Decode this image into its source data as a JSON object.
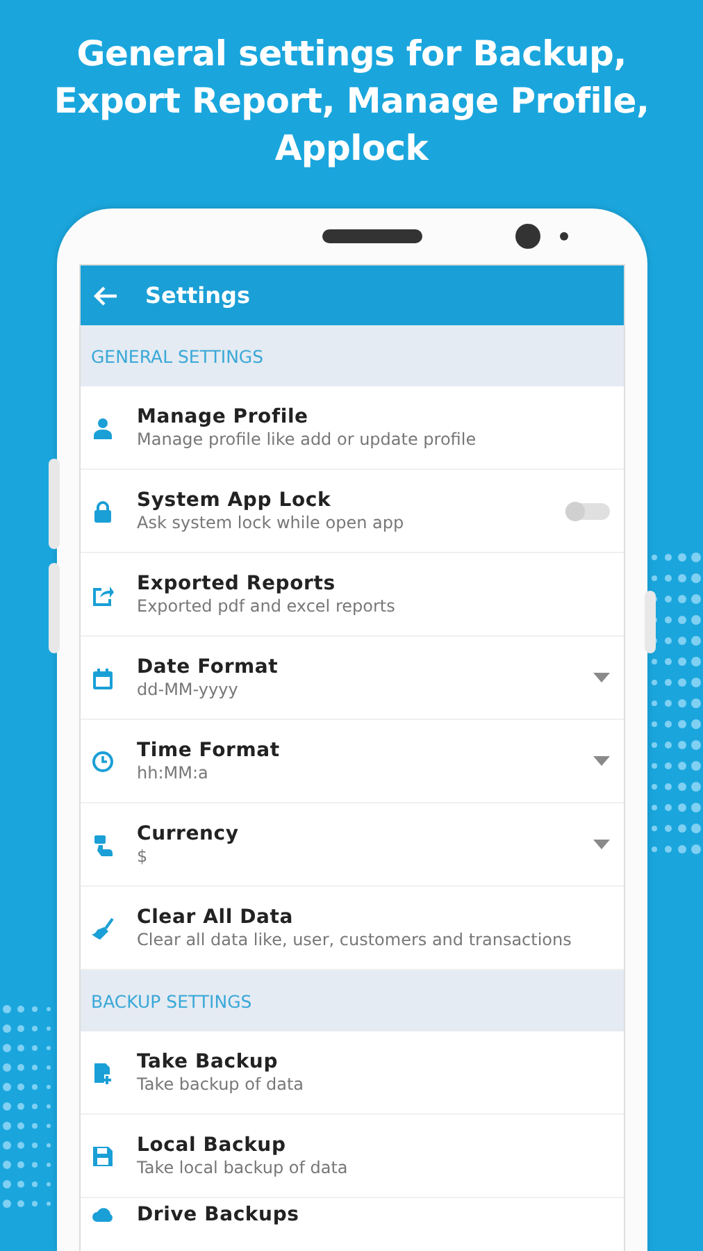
{
  "headline": "General settings for Backup, Export Report, Manage Profile, Applock",
  "app_bar": {
    "title": "Settings"
  },
  "sections": [
    {
      "header": "GENERAL SETTINGS",
      "items": [
        {
          "kind": "plain",
          "title": "Manage Profile",
          "subtitle": "Manage profile like add or update profile"
        },
        {
          "kind": "toggle",
          "title": "System App Lock",
          "subtitle": "Ask system lock while open app",
          "on": false
        },
        {
          "kind": "plain",
          "title": "Exported Reports",
          "subtitle": "Exported pdf and excel reports"
        },
        {
          "kind": "dropdown",
          "title": "Date Format",
          "subtitle": "dd-MM-yyyy"
        },
        {
          "kind": "dropdown",
          "title": "Time Format",
          "subtitle": "hh:MM:a"
        },
        {
          "kind": "dropdown",
          "title": "Currency",
          "subtitle": "$"
        },
        {
          "kind": "plain",
          "title": "Clear All Data",
          "subtitle": "Clear all data like, user, customers and transactions"
        }
      ]
    },
    {
      "header": "BACKUP SETTINGS",
      "items": [
        {
          "kind": "plain",
          "title": "Take Backup",
          "subtitle": "Take backup of data"
        },
        {
          "kind": "plain",
          "title": "Local Backup",
          "subtitle": "Take local backup of data"
        },
        {
          "kind": "plain",
          "title": "Drive Backups"
        }
      ]
    }
  ]
}
